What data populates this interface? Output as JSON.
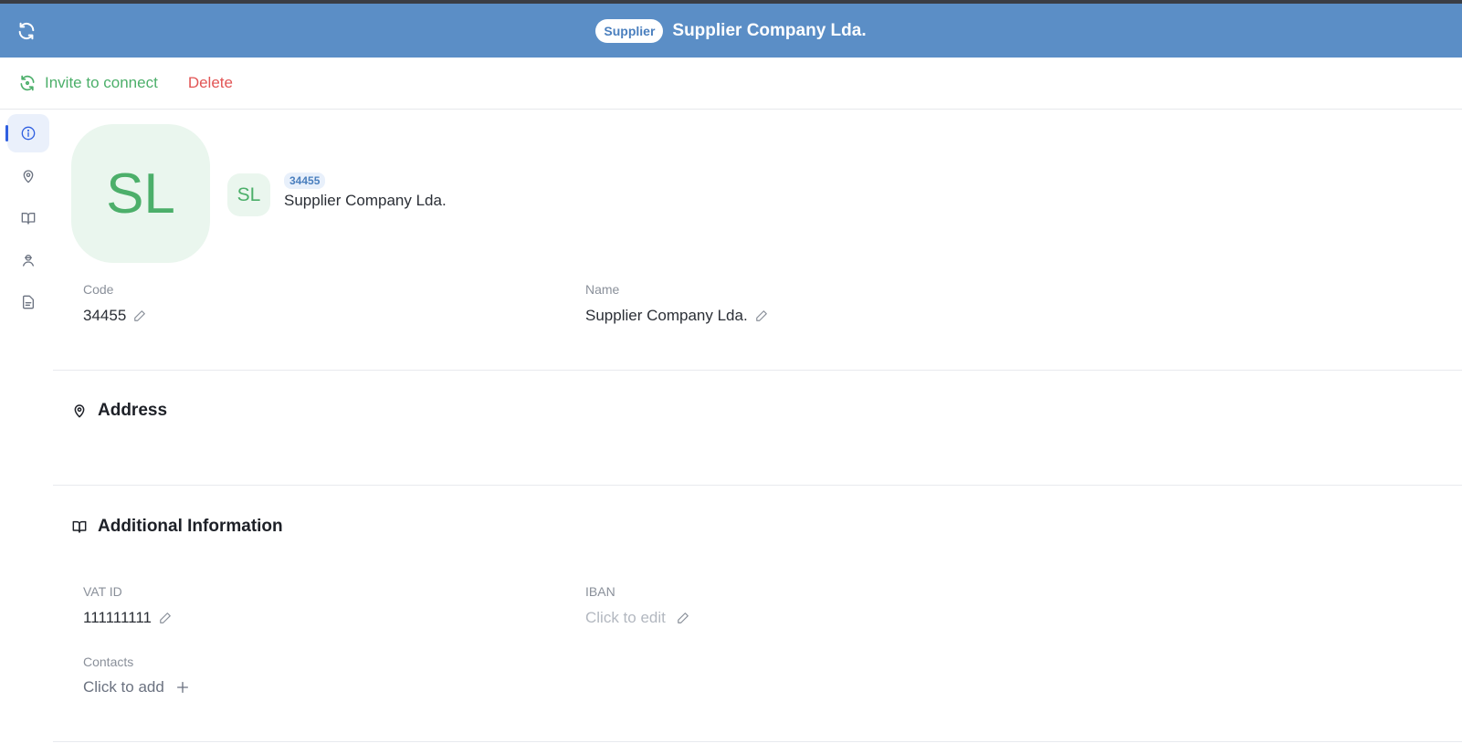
{
  "header": {
    "badge": "Supplier",
    "title": "Supplier Company Lda."
  },
  "toolbar": {
    "invite_label": "Invite to connect",
    "delete_label": "Delete"
  },
  "sidenav": {
    "items": [
      {
        "icon": "info-icon",
        "active": true
      },
      {
        "icon": "location-pin-icon",
        "active": false
      },
      {
        "icon": "book-icon",
        "active": false
      },
      {
        "icon": "contact-person-icon",
        "active": false
      },
      {
        "icon": "document-icon",
        "active": false
      }
    ]
  },
  "profile": {
    "initials": "SL",
    "code_chip": "34455",
    "name": "Supplier Company Lda."
  },
  "fields": {
    "code_label": "Code",
    "code_value": "34455",
    "name_label": "Name",
    "name_value": "Supplier Company Lda."
  },
  "address": {
    "title": "Address"
  },
  "additional": {
    "title": "Additional Information",
    "vat_label": "VAT ID",
    "vat_value": "111111111",
    "iban_label": "IBAN",
    "iban_placeholder": "Click to edit",
    "contacts_label": "Contacts",
    "contacts_placeholder": "Click to add"
  },
  "colors": {
    "header_bg": "#5b8ec6",
    "accent_green": "#4caf6a",
    "danger_red": "#e25555",
    "active_nav": "#2f5fe0"
  }
}
